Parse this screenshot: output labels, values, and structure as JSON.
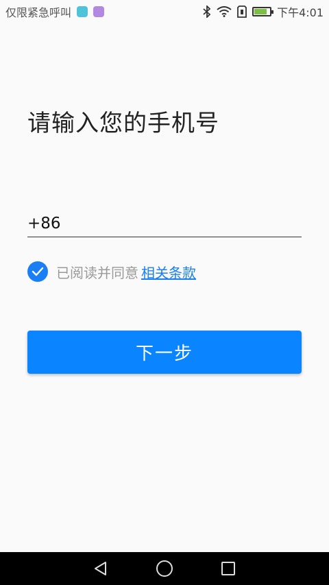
{
  "status_bar": {
    "carrier": "仅限紧急呼叫",
    "time": "下午4:01",
    "app_icons": [
      "android-app-icon",
      "gallery-app-icon"
    ],
    "battery_level": 0.8,
    "battery_charging": true
  },
  "page": {
    "title": "请输入您的手机号"
  },
  "phone_input": {
    "country_code": "+86",
    "value": "",
    "placeholder": ""
  },
  "agreement": {
    "checked": true,
    "text": "已阅读并同意",
    "link_text": "相关条款"
  },
  "next_button": {
    "label": "下一步"
  },
  "colors": {
    "accent": "#0a85ff",
    "link": "#1a7ff5",
    "background": "#fafafa"
  }
}
